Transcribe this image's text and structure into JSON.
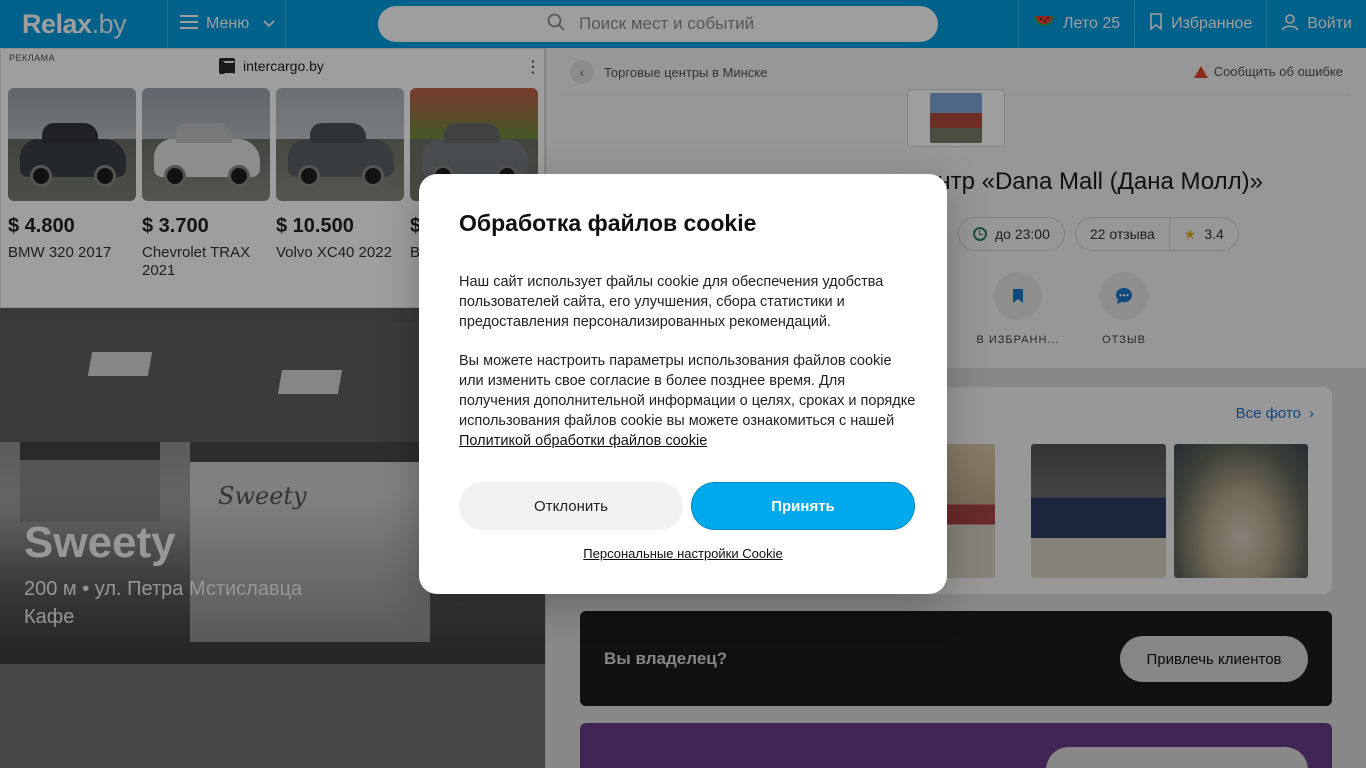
{
  "header": {
    "logo_main": "Relax",
    "logo_tld": ".by",
    "menu_label": "Меню",
    "search_placeholder": "Поиск мест и событий",
    "summer_label": "Лето 25",
    "favorites_label": "Избранное",
    "login_label": "Войти"
  },
  "ad": {
    "label": "РЕКЛАМА",
    "source": "intercargo.by",
    "cards": [
      {
        "price": "$ 4.800",
        "title": "BMW 320 2017",
        "color": "#3b4047"
      },
      {
        "price": "$ 3.700",
        "title": "Chevrolet TRAX 2021",
        "color": "#e4e4e4"
      },
      {
        "price": "$ 10.500",
        "title": "Volvo XC40 2022",
        "color": "#5b6166"
      },
      {
        "price": "$",
        "title": "B",
        "color": "#7a7e82"
      }
    ]
  },
  "promo": {
    "title": "Sweety",
    "subtitle": "200 м • ул. Петра Мстиславца",
    "category": "Кафе"
  },
  "place": {
    "breadcrumb": "Торговые центры в Минске",
    "report": "Сообщить об ошибке",
    "title_visible": "ентр «Dana Mall (Дана Молл)»",
    "hours": "до 23:00",
    "reviews": "22 отзыва",
    "rating": "3.4",
    "actions": [
      {
        "label": "В ИЗБРАНН..."
      },
      {
        "label": "ОТЗЫВ"
      }
    ],
    "all_photos": "Все фото",
    "owner_question": "Вы владелец?",
    "owner_button": "Привлечь клиентов"
  },
  "cookie": {
    "title": "Обработка файлов cookie",
    "paragraph1": "Наш сайт использует файлы cookie для обеспечения удобства пользователей сайта, его улучшения, сбора статистики и предоставления персонализированных рекомендаций.",
    "paragraph2": "Вы можете настроить параметры использования файлов cookie или изменить свое согласие в более позднее время. Для получения дополнительной информации о целях, сроках и порядке использования файлов cookie вы можете ознакомиться с нашей",
    "policy_link": "Политикой обработки файлов cookie",
    "decline": "Отклонить",
    "accept": "Принять",
    "settings": "Персональные настройки Cookie"
  },
  "colors": {
    "brand_blue": "#009de0",
    "accept_blue": "#00a8ec",
    "warning_red": "#e2472f"
  }
}
